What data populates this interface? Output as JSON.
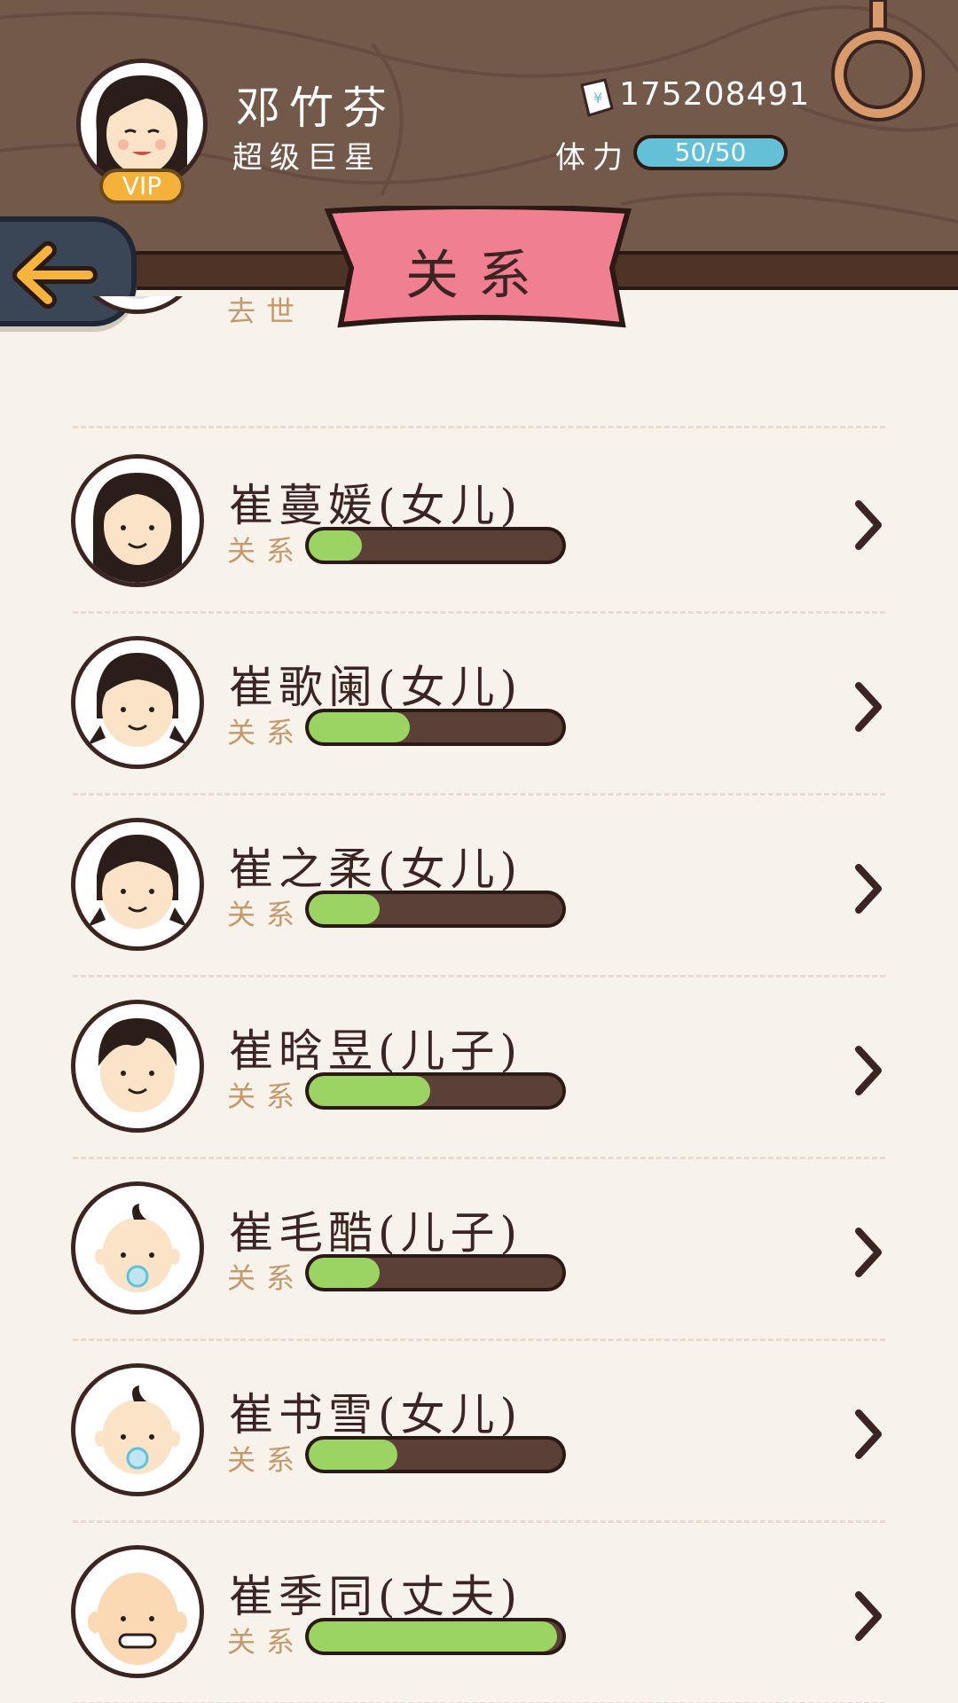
{
  "header": {
    "player_name": "邓竹芬",
    "player_title": "超级巨星",
    "vip_label": "VIP",
    "money_icon": "banknote-icon",
    "money_value": "175208491",
    "stamina_label": "体力",
    "stamina_text": "50/50",
    "stamina_fraction": 1.0,
    "page_title": "关系",
    "back_icon": "arrow-left-icon",
    "ring_icon": "hanging-ring-icon"
  },
  "list": {
    "partial_label": "去世",
    "relation_label": "关系",
    "items": [
      {
        "name": "崔蔓媛(女儿)",
        "relation": 0.21,
        "avatar": "girl-long-hair"
      },
      {
        "name": "崔歌阑(女儿)",
        "relation": 0.4,
        "avatar": "girl-pigtails"
      },
      {
        "name": "崔之柔(女儿)",
        "relation": 0.28,
        "avatar": "girl-pigtails"
      },
      {
        "name": "崔晗昱(儿子)",
        "relation": 0.48,
        "avatar": "boy"
      },
      {
        "name": "崔毛酷(儿子)",
        "relation": 0.28,
        "avatar": "baby"
      },
      {
        "name": "崔书雪(女儿)",
        "relation": 0.35,
        "avatar": "baby"
      },
      {
        "name": "崔季同(丈夫)",
        "relation": 0.98,
        "avatar": "bald-man"
      }
    ]
  },
  "colors": {
    "header_wood": "#73594a",
    "ribbon": "#f07f92",
    "relation_fill": "#9bd462",
    "stamina_fill": "#64c0d6",
    "vip": "#f4b23b"
  }
}
